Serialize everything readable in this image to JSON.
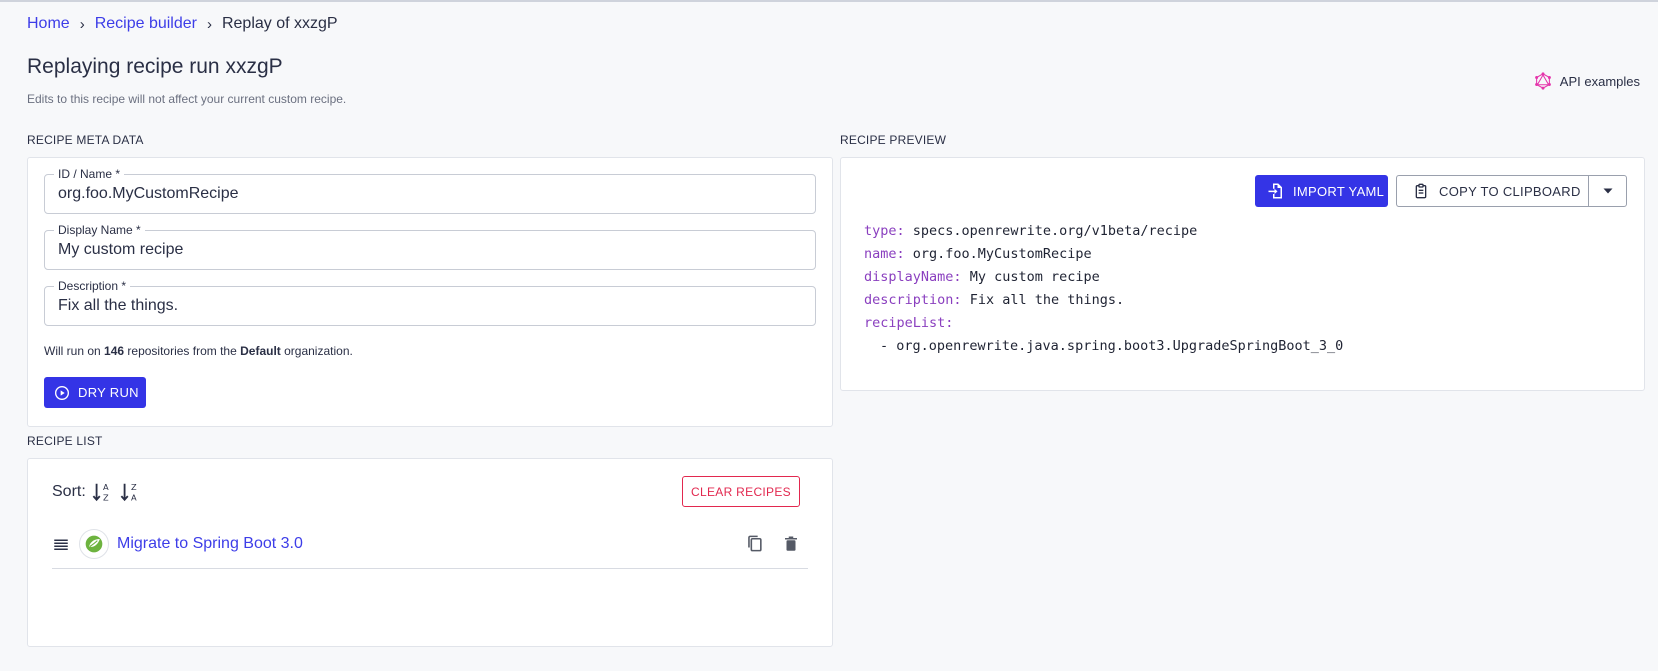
{
  "breadcrumb": {
    "home": "Home",
    "builder": "Recipe builder",
    "current": "Replay of xxzgP",
    "sep": "›"
  },
  "header": {
    "title": "Replaying recipe run xxzgP",
    "subtitle": "Edits to this recipe will not affect your current custom recipe.",
    "api_examples": "API examples"
  },
  "meta": {
    "section_label": "RECIPE META DATA",
    "id_label": "ID / Name",
    "id_value": "org.foo.MyCustomRecipe",
    "display_label": "Display Name",
    "display_value": "My custom recipe",
    "desc_label": "Description",
    "desc_value": "Fix all the things.",
    "required_mark": "*",
    "run_note_prefix": "Will run on ",
    "run_count": "146",
    "run_note_mid": " repositories from the ",
    "org_name": "Default",
    "run_note_suffix": " organization.",
    "dry_run_label": "DRY RUN"
  },
  "recipe_list": {
    "section_label": "RECIPE LIST",
    "sort_label": "Sort:",
    "clear_label": "CLEAR RECIPES",
    "items": [
      {
        "title": "Migrate to Spring Boot 3.0"
      }
    ]
  },
  "preview": {
    "section_label": "RECIPE PREVIEW",
    "import_label": "IMPORT YAML",
    "copy_label": "COPY TO CLIPBOARD",
    "yaml": {
      "type_key": "type:",
      "type_val": "specs.openrewrite.org/v1beta/recipe",
      "name_key": "name:",
      "name_val": "org.foo.MyCustomRecipe",
      "display_key": "displayName:",
      "display_val": "My custom recipe",
      "desc_key": "description:",
      "desc_val": "Fix all the things.",
      "list_key": "recipeList:",
      "list_item": "- org.openrewrite.java.spring.boot3.UpgradeSpringBoot_3_0"
    }
  },
  "colors": {
    "primary": "#3434e6",
    "link": "#3d3de8",
    "danger": "#e2284f",
    "yaml_key": "#8a3fbf",
    "graphql_pink": "#e535ab",
    "spring_green": "#6db33f"
  },
  "icons": {
    "api": "graphql-icon",
    "dry_run": "play-circle-icon",
    "import": "import-file-icon",
    "copy": "clipboard-icon",
    "dropdown": "caret-down-icon",
    "sort_asc": "sort-alpha-asc-icon",
    "sort_desc": "sort-alpha-desc-icon",
    "drag": "drag-handle-icon",
    "spring": "spring-logo-icon",
    "duplicate": "duplicate-icon",
    "delete": "trash-icon"
  }
}
